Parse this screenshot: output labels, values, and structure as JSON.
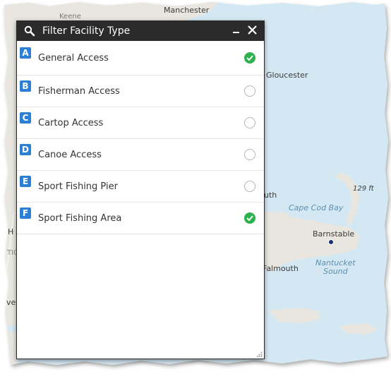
{
  "panel": {
    "title": "Filter Facility Type",
    "header_icon": "search-icon",
    "minimize_icon": "minimize-icon",
    "close_icon": "close-icon"
  },
  "items": [
    {
      "letter": "A",
      "label": "General Access",
      "selected": true
    },
    {
      "letter": "B",
      "label": "Fisherman Access",
      "selected": false
    },
    {
      "letter": "C",
      "label": "Cartop Access",
      "selected": false
    },
    {
      "letter": "D",
      "label": "Canoe Access",
      "selected": false
    },
    {
      "letter": "E",
      "label": "Sport Fishing Pier",
      "selected": false
    },
    {
      "letter": "F",
      "label": "Sport Fishing Area",
      "selected": true
    }
  ],
  "map": {
    "labels": {
      "manchester": "Manchester",
      "gloucester": "Gloucester",
      "cape_cod_bay": "Cape Cod Bay",
      "barnstable": "Barnstable",
      "falmouth": "Falmouth",
      "nantucket_sound_1": "Nantucket",
      "nantucket_sound_2": "Sound",
      "elevation": "129 ft",
      "plymouth_partial": "uth",
      "left_h": "H",
      "left_tio": "TIO",
      "left_ve": "ve",
      "kearsarge": "Keene"
    }
  },
  "colors": {
    "badge": "#2b7fd4",
    "check": "#2bb24c",
    "header": "#2b2b2b",
    "water": "#d4e8f3",
    "land": "#e8e6df"
  }
}
